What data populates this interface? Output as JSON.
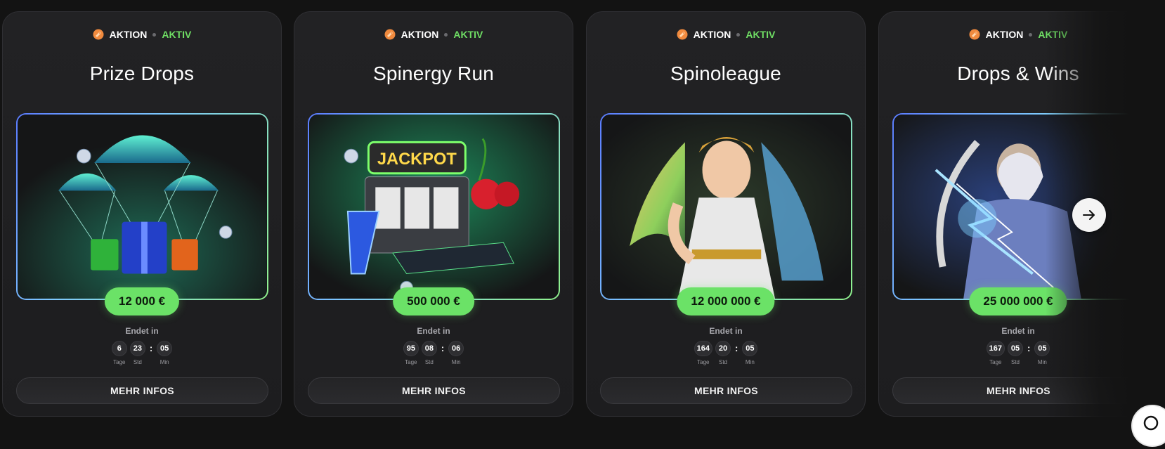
{
  "accent_color": "#6be267",
  "cards": [
    {
      "badge": {
        "label": "AKTION",
        "status": "AKTIV"
      },
      "title": "Prize Drops",
      "prize": "12 000 €",
      "ends_label": "Endet in",
      "timer": {
        "days": "6",
        "hours": "23",
        "minutes": "05"
      },
      "units": {
        "days": "Tage",
        "hours": "Std",
        "minutes": "Min"
      },
      "button": "MEHR INFOS",
      "image_icon": "parachute-gifts-image"
    },
    {
      "badge": {
        "label": "AKTION",
        "status": "AKTIV"
      },
      "title": "Spinergy Run",
      "prize": "500 000 €",
      "ends_label": "Endet in",
      "timer": {
        "days": "95",
        "hours": "08",
        "minutes": "06"
      },
      "units": {
        "days": "Tage",
        "hours": "Std",
        "minutes": "Min"
      },
      "button": "MEHR INFOS",
      "image_icon": "jackpot-slot-machine-image",
      "image_text": "JACKPOT"
    },
    {
      "badge": {
        "label": "AKTION",
        "status": "AKTIV"
      },
      "title": "Spinoleague",
      "prize": "12 000 000 €",
      "ends_label": "Endet in",
      "timer": {
        "days": "164",
        "hours": "20",
        "minutes": "05"
      },
      "units": {
        "days": "Tage",
        "hours": "Std",
        "minutes": "Min"
      },
      "button": "MEHR INFOS",
      "image_icon": "goddess-image"
    },
    {
      "badge": {
        "label": "AKTION",
        "status": "AKTIV"
      },
      "title": "Drops & Wins",
      "prize": "25 000 000 €",
      "ends_label": "Endet in",
      "timer": {
        "days": "167",
        "hours": "05",
        "minutes": "05"
      },
      "units": {
        "days": "Tage",
        "hours": "Std",
        "minutes": "Min"
      },
      "button": "MEHR INFOS",
      "image_icon": "zeus-lightning-image"
    }
  ],
  "controls": {
    "next_icon": "arrow-right-icon",
    "chat_icon": "chat-icon"
  }
}
